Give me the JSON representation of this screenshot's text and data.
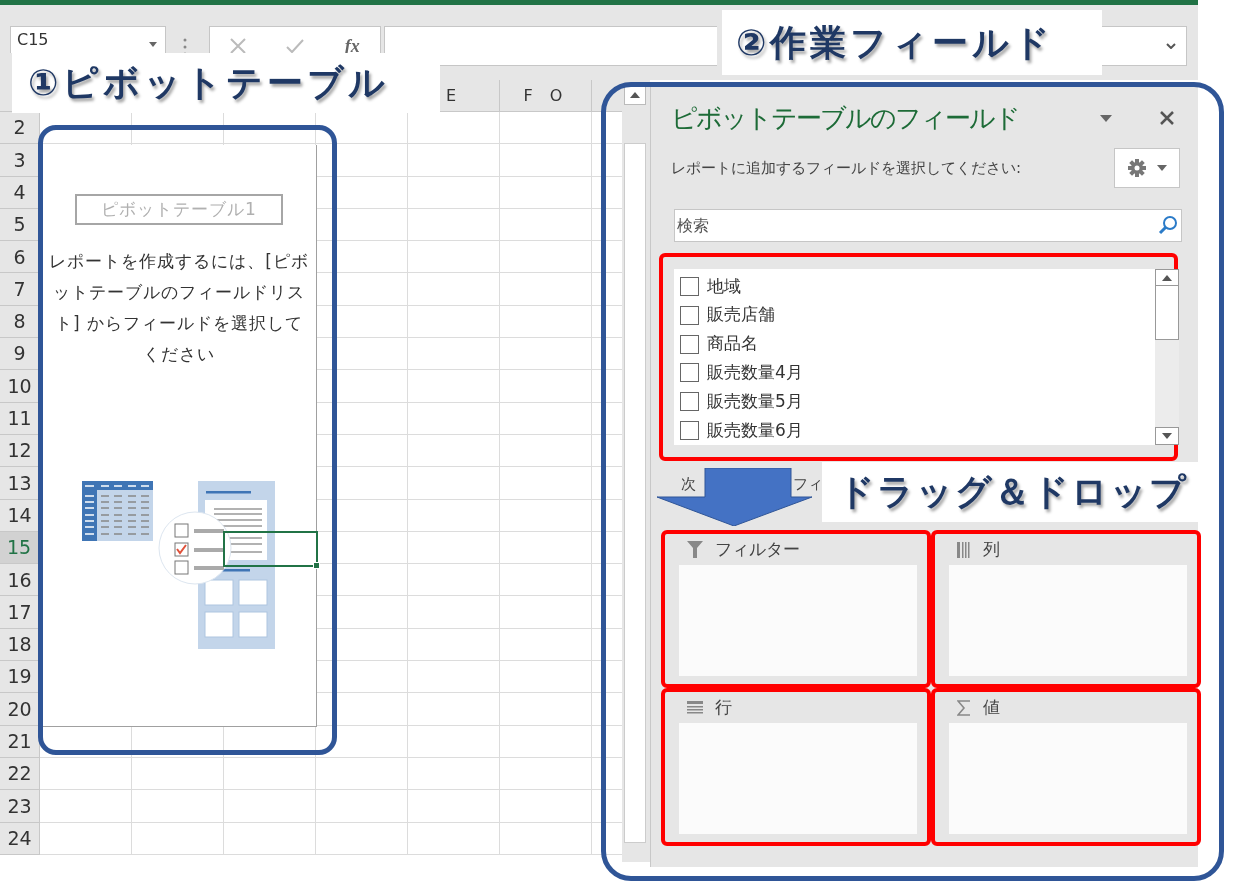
{
  "formula_bar": {
    "name_box": "C15",
    "function_button": "fx"
  },
  "sheet": {
    "columns": [
      {
        "label": "E"
      },
      {
        "label": "F O"
      }
    ],
    "rows": [
      {
        "label": "2",
        "selected": false
      },
      {
        "label": "3",
        "selected": false
      },
      {
        "label": "4",
        "selected": false
      },
      {
        "label": "5",
        "selected": false
      },
      {
        "label": "6",
        "selected": false
      },
      {
        "label": "7",
        "selected": false
      },
      {
        "label": "8",
        "selected": false
      },
      {
        "label": "9",
        "selected": false
      },
      {
        "label": "10",
        "selected": false
      },
      {
        "label": "11",
        "selected": false
      },
      {
        "label": "12",
        "selected": false
      },
      {
        "label": "13",
        "selected": false
      },
      {
        "label": "14",
        "selected": false
      },
      {
        "label": "15",
        "selected": true
      },
      {
        "label": "16",
        "selected": false
      },
      {
        "label": "17",
        "selected": false
      },
      {
        "label": "18",
        "selected": false
      },
      {
        "label": "19",
        "selected": false
      },
      {
        "label": "20",
        "selected": false
      },
      {
        "label": "21",
        "selected": false
      },
      {
        "label": "22",
        "selected": false
      },
      {
        "label": "23",
        "selected": false
      },
      {
        "label": "24",
        "selected": false
      }
    ]
  },
  "pivot_placeholder": {
    "title": "ピボットテーブル1",
    "message": "レポートを作成するには、[ピボットテーブルのフィールドリスト] からフィールドを選択してください"
  },
  "field_pane": {
    "title": "ピボットテーブルのフィールド",
    "prompt": "レポートに追加するフィールドを選択してください:",
    "search": {
      "placeholder": "検索"
    },
    "fields": [
      {
        "label": "地域",
        "checked": false
      },
      {
        "label": "販売店舗",
        "checked": false
      },
      {
        "label": "商品名",
        "checked": false
      },
      {
        "label": "販売数量4月",
        "checked": false
      },
      {
        "label": "販売数量5月",
        "checked": false
      },
      {
        "label": "販売数量6月",
        "checked": false
      }
    ],
    "drag_hint": [
      "次",
      "フィ"
    ],
    "areas": [
      {
        "kind": "filter",
        "label": "フィルター"
      },
      {
        "kind": "columns",
        "label": "列"
      },
      {
        "kind": "rows",
        "label": "行"
      },
      {
        "kind": "values",
        "label": "値"
      }
    ]
  },
  "callouts": {
    "pivot_table": "①ピボットテーブル",
    "work_field": "②作業フィールド",
    "drag_drop": "ドラッグ＆ドロップ"
  }
}
